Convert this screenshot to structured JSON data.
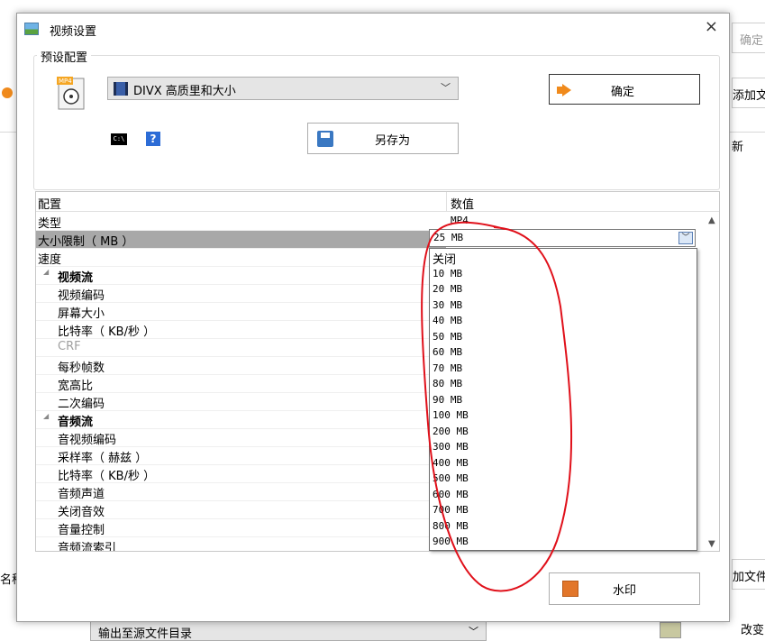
{
  "background": {
    "right_top_button": "确定",
    "add_file_1": "添加文",
    "new_label": "新",
    "name_label": "名称",
    "add_file_2": "加文件",
    "change_label": "改变",
    "output_dir": "输出至源文件目录"
  },
  "dialog": {
    "title": "视频设置",
    "close": "×",
    "group_legend": "预设配置",
    "preset_value": "DIVX 高质里和大小",
    "ok_button": "确定",
    "save_as_button": "另存为",
    "cmd_icon_text": "C:\\",
    "help_icon_text": "?",
    "watermark_button": "水印"
  },
  "grid": {
    "header_config": "配置",
    "header_value": "数值",
    "rows": [
      {
        "label": "类型",
        "value": "MP4",
        "kind": "normal"
      },
      {
        "label": "大小限制（ MB ）",
        "value": "25 MB",
        "kind": "selected"
      },
      {
        "label": "速度",
        "value": "",
        "kind": "normal"
      },
      {
        "label": "视频流",
        "value": "",
        "kind": "category"
      },
      {
        "label": "视频编码",
        "value": "",
        "kind": "child"
      },
      {
        "label": "屏幕大小",
        "value": "",
        "kind": "child"
      },
      {
        "label": "比特率（ KB/秒 ）",
        "value": "",
        "kind": "child"
      },
      {
        "label": "CRF",
        "value": "",
        "kind": "disabled"
      },
      {
        "label": "每秒帧数",
        "value": "",
        "kind": "child"
      },
      {
        "label": "宽高比",
        "value": "",
        "kind": "child"
      },
      {
        "label": "二次编码",
        "value": "",
        "kind": "child"
      },
      {
        "label": "音频流",
        "value": "",
        "kind": "category"
      },
      {
        "label": "音视频编码",
        "value": "",
        "kind": "child"
      },
      {
        "label": "采样率（ 赫兹 ）",
        "value": "",
        "kind": "child"
      },
      {
        "label": "比特率（ KB/秒 ）",
        "value": "",
        "kind": "child"
      },
      {
        "label": "音频声道",
        "value": "",
        "kind": "child"
      },
      {
        "label": "关闭音效",
        "value": "",
        "kind": "child"
      },
      {
        "label": "音量控制",
        "value": "",
        "kind": "child"
      },
      {
        "label": "音频流索引",
        "value": "",
        "kind": "child"
      }
    ]
  },
  "size_combo": {
    "current": "25 MB",
    "options": [
      "关闭",
      "10 MB",
      "20 MB",
      "30 MB",
      "40 MB",
      "50 MB",
      "60 MB",
      "70 MB",
      "80 MB",
      "90 MB",
      "100 MB",
      "200 MB",
      "300 MB",
      "400 MB",
      "500 MB",
      "600 MB",
      "700 MB",
      "800 MB",
      "900 MB"
    ]
  },
  "colors": {
    "accent_orange": "#f08a1c",
    "annotation_red": "#e0101a",
    "selected_row": "#a8a8a8"
  }
}
